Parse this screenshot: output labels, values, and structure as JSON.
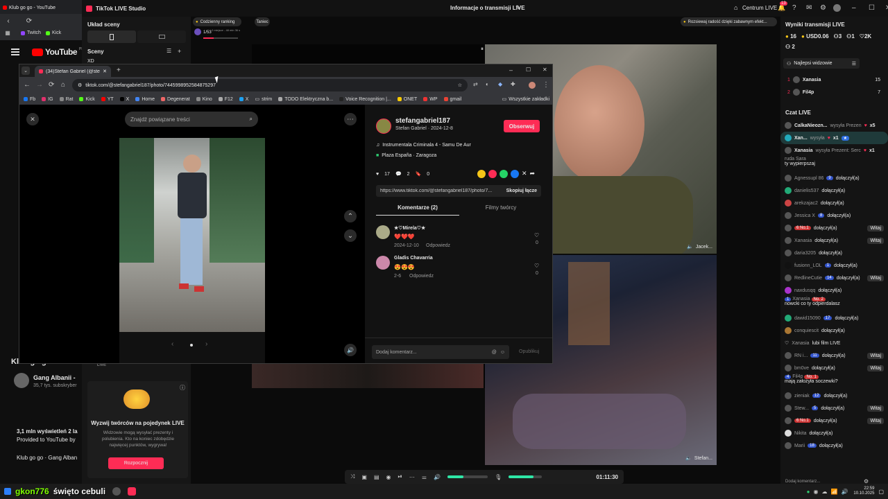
{
  "youtube": {
    "tab_title": "Klub go go - YouTube",
    "bookmarks": [
      "Twitch",
      "Kick"
    ],
    "logo": "YouTube",
    "logo_suffix": "PL",
    "video_title": "Klub go go",
    "channel": "Gang Albanii -",
    "subscribers": "35,7 tys. subskryber",
    "views": "3,1 mln wyświetleń  2 la",
    "provided": "Provided to YouTube by",
    "desc": "Klub go go · Gang Alban"
  },
  "studio": {
    "app_title": "TikTok LIVE Studio",
    "center_title": "Informacje o transmisji LIVE",
    "centrum": "Centrum LIVE",
    "notif_count": "13",
    "scene_layout": "Układ sceny",
    "scenes": "Sceny",
    "scene_name": "XD",
    "ranking": "Codzienny ranking",
    "ranking_sub": "2 miejsce - 48 min 36 s",
    "dance": "Taniec",
    "score": "1/53",
    "banner": "Rozsiewaj radość dzięki zabawnym efekt...",
    "live_tag": "LIVE",
    "battle_title": "Wyzwij twórców na pojedynek LIVE",
    "battle_desc": "Widzowie mogą wysyłać prezenty i polubienia. Kto na koniec zdobędzie najwięcej punktów, wygrywa!",
    "battle_btn": "Rozpocznij",
    "timer": "01:11:30",
    "video_label_1": "Jacek...",
    "video_label_2": "Stefan..."
  },
  "results": {
    "title": "Wyniki transmisji LIVE",
    "stats": [
      "16",
      "USD0.06",
      "3",
      "1",
      "2K",
      "2"
    ],
    "top_viewers_title": "Najlepsi widzowie",
    "top_viewers": [
      {
        "rank": "1",
        "name": "Xanasia",
        "score": "15"
      },
      {
        "rank": "2",
        "name": "Fil4p",
        "score": "7"
      }
    ]
  },
  "chat": {
    "title": "Czat LIVE",
    "input_placeholder": "Dodaj komentarz...",
    "welcome": "Witaj",
    "messages": [
      {
        "user": "CalkaNieozn...",
        "text": "wysyła Prezen",
        "extra": "x5"
      },
      {
        "user": "Xan...",
        "text": "wysyła",
        "extra": "x1"
      },
      {
        "user": "Xanasia",
        "text": "wysyła Prezent: Serc",
        "extra": "x1"
      },
      {
        "user": "ruda Sara",
        "text": "ty wypierpszaj",
        "extra": ""
      },
      {
        "user": "Agnessupl 86",
        "text": "dołączył(a)",
        "extra": ""
      },
      {
        "user": "danielis537",
        "text": "dołączył(a)",
        "extra": ""
      },
      {
        "user": "arekzajac2",
        "text": "dołączył(a)",
        "extra": ""
      },
      {
        "user": "Jessica X",
        "text": "dołączył(a)",
        "extra": ""
      },
      {
        "user": "6 No.1",
        "text": "dołączył(a)",
        "extra": "Witaj"
      },
      {
        "user": "Xanasia",
        "text": "dołączył(a)",
        "extra": "Witaj"
      },
      {
        "user": "daria3205",
        "text": "dołączył(a)",
        "extra": ""
      },
      {
        "user": "fusionn_LOL",
        "text": "dołączył(a)",
        "extra": ""
      },
      {
        "user": "RedlineCutie",
        "text": "dołączył(a)",
        "extra": "Witaj"
      },
      {
        "user": "naxdusqq",
        "text": "dołączył(a)",
        "extra": ""
      },
      {
        "user": "Xanasia",
        "text": "nowcki co ty odpierdalasz",
        "extra": ""
      },
      {
        "user": "dawid15090",
        "text": "dołączył(a)",
        "extra": ""
      },
      {
        "user": "conquiescit",
        "text": "dołączył(a)",
        "extra": ""
      },
      {
        "user": "Xanasia",
        "text": "lubi film LIVE",
        "extra": ""
      },
      {
        "user": "RN i...",
        "text": "dołączył(a)",
        "extra": "Witaj"
      },
      {
        "user": "bm0ve",
        "text": "dołączył(a)",
        "extra": "Witaj"
      },
      {
        "user": "Fil4p",
        "text": "mają założyła soczewki?",
        "extra": ""
      },
      {
        "user": "zieniak",
        "text": "dołączył(a)",
        "extra": ""
      },
      {
        "user": "Stew...",
        "text": "dołączył(a)",
        "extra": "Witaj"
      },
      {
        "user": "6 No.1",
        "text": "dołączył(a)",
        "extra": "Witaj"
      },
      {
        "user": "Nikita",
        "text": "dołączył(a)",
        "extra": ""
      },
      {
        "user": "Marii",
        "text": "dołączył(a)",
        "extra": ""
      }
    ]
  },
  "chrome": {
    "tab_title": "(34)Stefan Gabriel (@stefa...",
    "url": "tiktok.com/@stefangabriel187/photo/7445998952584875297",
    "bookmarks": [
      "Fb",
      "IG",
      "Rat",
      "Kick",
      "YT",
      "X",
      "Home",
      "Degenerat",
      "Kino",
      "F12",
      "X",
      "strim",
      "TODO Elektryczna b...",
      "Voice Recognition |...",
      "ONET",
      "WP",
      "gmail"
    ],
    "all_bookmarks": "Wszystkie zakładki"
  },
  "tiktok": {
    "search_placeholder": "Znajdź powiązane treści",
    "username": "stefangabriel187",
    "display": "Stefan Gabriel · 2024-12-8",
    "follow": "Obserwuj",
    "music": "Instrumentala Criminala 4 - Samu De Aur",
    "location": "Plaza España · Zaragoza",
    "likes": "17",
    "comments_count": "2",
    "saves": "0",
    "share_url": "https://www.tiktok.com/@stefangabriel187/photo/7...",
    "copy_link": "Skopiuj łącze",
    "tab_comments": "Komentarze (2)",
    "tab_creator": "Filmy twórcy",
    "comments": [
      {
        "name": "★♡Mirela♡★",
        "text": "❤️❤️❤️",
        "date": "2024-12-10",
        "reply": "Odpowiedz",
        "likes": "0"
      },
      {
        "name": "Gladis Chavarria",
        "text": "😍😍😍",
        "date": "2-6",
        "reply": "Odpowiedz",
        "likes": "0"
      }
    ],
    "add_comment": "Dodaj komentarz...",
    "post": "Opublikuj"
  },
  "taskbar": {
    "text": "gkon776",
    "title": "święto cebuli",
    "time": "22:59",
    "date": "10.10.2025"
  },
  "colors": {
    "accent": "#fe2c55",
    "bg": "#0e0e10",
    "chrome": "#1f1f1f",
    "blue": "#3355cc"
  }
}
